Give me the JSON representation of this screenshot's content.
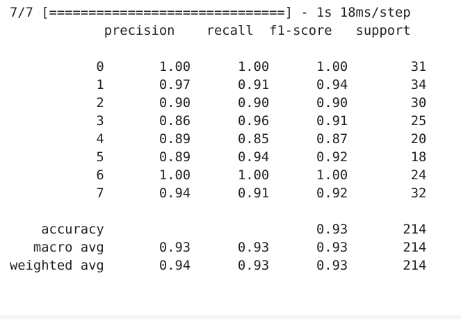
{
  "output": {
    "progress_line": "7/7 [==============================] - 1s 18ms/step",
    "report": {
      "header": [
        "precision",
        "recall",
        "f1-score",
        "support"
      ],
      "rows": [
        {
          "label": "0",
          "precision": "1.00",
          "recall": "1.00",
          "f1": "1.00",
          "support": "31"
        },
        {
          "label": "1",
          "precision": "0.97",
          "recall": "0.91",
          "f1": "0.94",
          "support": "34"
        },
        {
          "label": "2",
          "precision": "0.90",
          "recall": "0.90",
          "f1": "0.90",
          "support": "30"
        },
        {
          "label": "3",
          "precision": "0.86",
          "recall": "0.96",
          "f1": "0.91",
          "support": "25"
        },
        {
          "label": "4",
          "precision": "0.89",
          "recall": "0.85",
          "f1": "0.87",
          "support": "20"
        },
        {
          "label": "5",
          "precision": "0.89",
          "recall": "0.94",
          "f1": "0.92",
          "support": "18"
        },
        {
          "label": "6",
          "precision": "1.00",
          "recall": "1.00",
          "f1": "1.00",
          "support": "24"
        },
        {
          "label": "7",
          "precision": "0.94",
          "recall": "0.91",
          "f1": "0.92",
          "support": "32"
        }
      ],
      "summary": [
        {
          "label": "accuracy",
          "precision": "",
          "recall": "",
          "f1": "0.93",
          "support": "214"
        },
        {
          "label": "macro avg",
          "precision": "0.93",
          "recall": "0.93",
          "f1": "0.93",
          "support": "214"
        },
        {
          "label": "weighted avg",
          "precision": "0.94",
          "recall": "0.93",
          "f1": "0.93",
          "support": "214"
        }
      ]
    }
  }
}
